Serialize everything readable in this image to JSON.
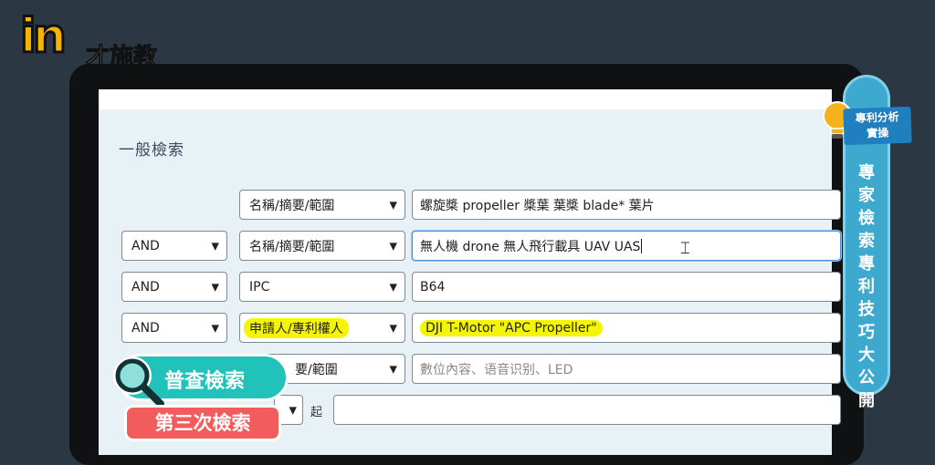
{
  "logo": {
    "mark": "in",
    "text": "才施教"
  },
  "search": {
    "section_title": "一般檢索",
    "rows": [
      {
        "op": "",
        "field": "名稱/摘要/範圍",
        "query": "螺旋槳 propeller 槳葉 葉槳 blade* 葉片"
      },
      {
        "op": "AND",
        "field": "名稱/摘要/範圍",
        "query": "無人機 drone 無人飛行載具 UAV UAS"
      },
      {
        "op": "AND",
        "field": "IPC",
        "query": "B64"
      },
      {
        "op": "AND",
        "field": "申請人/專利權人",
        "query": "DJI T-Motor \"APC Propeller\""
      },
      {
        "op": "",
        "field": "要/範圍",
        "query": "數位內容、语音识别、LED"
      }
    ],
    "from_label": "起"
  },
  "banner": {
    "badge_line1": "專利分析",
    "badge_line2": "實操",
    "vertical_text": "專家檢索專利技巧大公開"
  },
  "overlay": {
    "pucha": "普查檢索",
    "third": "第三次檢索"
  },
  "colors": {
    "background": "#2b3844",
    "screen": "#e7f1f6",
    "banner": "#3ea9cf",
    "highlight": "#f5f500",
    "pucha": "#21c2ba",
    "third": "#f25c5c"
  }
}
